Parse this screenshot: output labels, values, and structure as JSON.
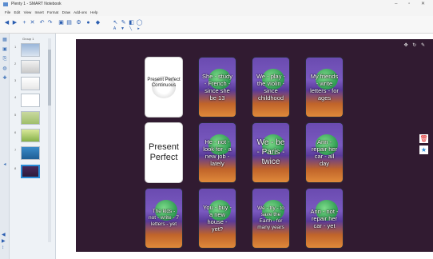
{
  "window": {
    "title": "Plenty 1 - SMART Notebook"
  },
  "menu": [
    "File",
    "Edit",
    "View",
    "Insert",
    "Format",
    "Draw",
    "Add-ons",
    "Help"
  ],
  "toolbar": {
    "buttons": [
      "back-icon",
      "forward-icon",
      "add-page-icon",
      "delete-page-icon",
      "undo-icon",
      "redo-icon",
      "select-icon",
      "pen-icon",
      "eraser-icon",
      "shapes-icon",
      "text-icon",
      "fill-icon"
    ]
  },
  "sidebar": {
    "tab_label": "Group 1",
    "page_numbers": [
      "1",
      "2",
      "3",
      "4",
      "5",
      "6",
      "7",
      "8"
    ],
    "selected_page": 8
  },
  "canvas": {
    "background": "#311b31",
    "cards": [
      {
        "style": "white",
        "text": "Present Perfect Continuous",
        "size": "small"
      },
      {
        "style": "picture",
        "text": "She - study - French - since she be 13"
      },
      {
        "style": "picture",
        "text": "We - play - the violin - since childhood"
      },
      {
        "style": "picture",
        "text": "My friends - write letters - for ages"
      },
      {
        "style": "white",
        "text": "Present Perfect",
        "size": "big"
      },
      {
        "style": "picture",
        "text": "He - not - look for - a new job - lately"
      },
      {
        "style": "picture",
        "text": "We - be - Paris - twice"
      },
      {
        "style": "picture",
        "text": "Ann - repair her car - all day"
      },
      {
        "style": "picture",
        "text": "The kids - not - write - 7 letters - yet"
      },
      {
        "style": "picture",
        "text": "You - buy - a new house - yet?"
      },
      {
        "style": "picture",
        "text": "We - try - to save the Earth - for many years"
      },
      {
        "style": "picture",
        "text": "Ann - not - repair her car - yet"
      }
    ]
  },
  "right_tools": [
    "trash-icon",
    "star-icon"
  ],
  "colors": {
    "accent": "#2a8bd6",
    "canvas": "#311b31",
    "blob": "#2f9b52"
  }
}
